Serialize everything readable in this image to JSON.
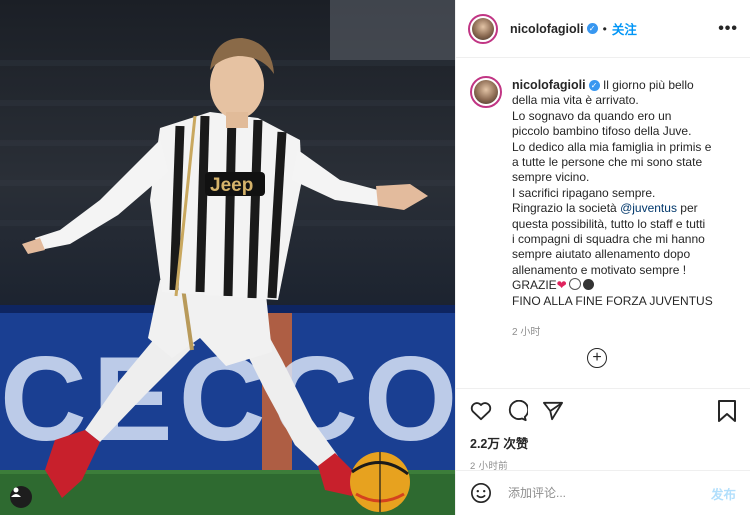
{
  "post": {
    "username": "nicolofagioli",
    "verified_icon": "verified-badge-icon",
    "separator": "•",
    "follow_label": "关注",
    "more_label": "•••"
  },
  "caption": {
    "username": "nicolofagioli",
    "lines": [
      "Il giorno più bello",
      "della mia vita è arrivato.",
      "Lo sognavo da quando ero un",
      "piccolo bambino tifoso della Juve.",
      "Lo dedico alla mia famiglia in primis e",
      "a tutte le persone che mi sono state",
      "sempre vicino.",
      "I sacrifici ripagano sempre.",
      "Ringrazio la società",
      "@juventus",
      "per",
      "questa possibilità, tutto lo staff e tutti",
      "i compagni di squadra che mi hanno",
      "sempre aiutato allenamento dopo",
      "allenamento e motivato sempre !",
      "GRAZIE",
      "FINO ALLA FINE FORZA JUVENTUS"
    ],
    "time": "2 小时"
  },
  "load_more": "+",
  "actions": {
    "icons": [
      "heart-icon",
      "comment-icon",
      "share-icon",
      "bookmark-icon"
    ],
    "likes": "2.2万 次赞",
    "time": "2 小时前"
  },
  "comment_box": {
    "emoji_icon": "emoji-icon",
    "placeholder": "添加评论...",
    "post_label": "发布"
  },
  "colors": {
    "accent": "#0095f6",
    "verified": "#3897f0",
    "muted": "#8e8e8e",
    "post_disabled": "#b2dffc",
    "mention": "#00376b"
  },
  "photo": {
    "banner_text": "CECCO DE",
    "jersey_text": "Jeep"
  }
}
